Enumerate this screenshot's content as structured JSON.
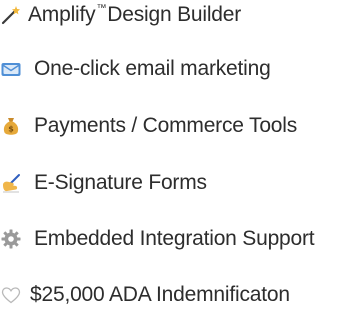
{
  "features": [
    {
      "label_brand": "Amplify",
      "label_mark": "™",
      "label_rest": "Design Builder",
      "icon": "magic-wand-icon"
    },
    {
      "label": "One-click email marketing",
      "icon": "email-icon"
    },
    {
      "label": "Payments / Commerce Tools",
      "icon": "money-bag-icon"
    },
    {
      "label": "E-Signature Forms",
      "icon": "writing-hand-icon"
    },
    {
      "label": "Embedded Integration Support",
      "icon": "gear-icon"
    },
    {
      "label": "$25,000 ADA Indemnificaton",
      "icon": "heart-outline-icon"
    }
  ],
  "colors": {
    "text": "#2d2d2d",
    "gold": "#e6a93a",
    "email_blue": "#4f8fd6",
    "gear_gray": "#9a9a9a"
  }
}
